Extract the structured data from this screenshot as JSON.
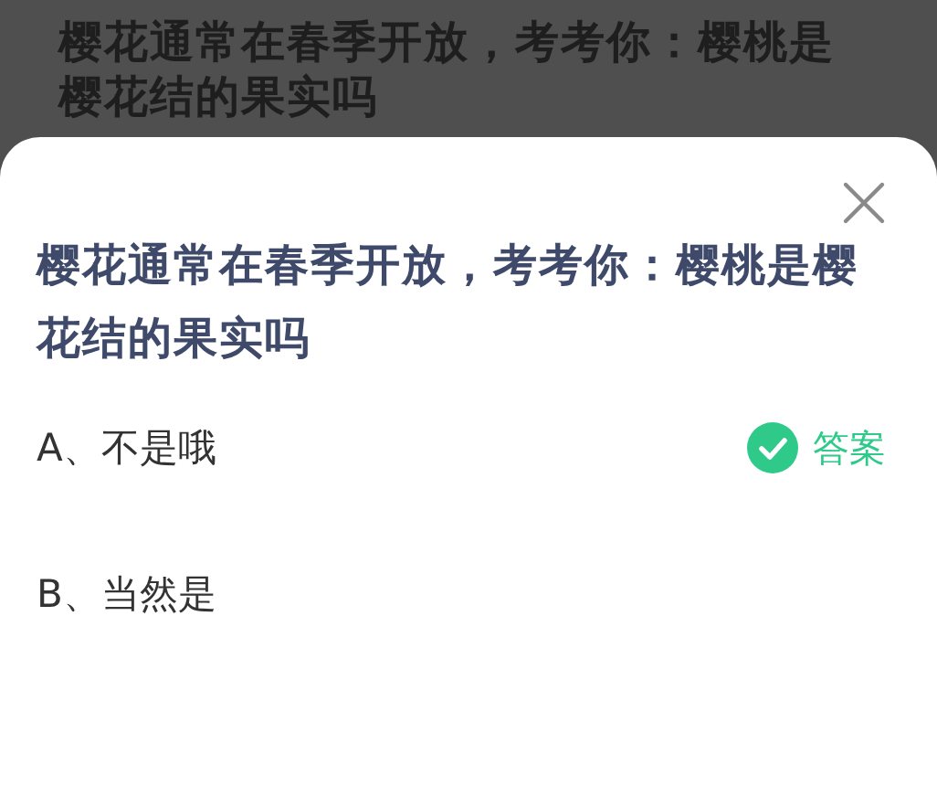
{
  "background_page": {
    "title": "樱花通常在春季开放，考考你：樱桃是樱花结的果实吗"
  },
  "dialog": {
    "question": "樱花通常在春季开放，考考你：樱桃是樱花结的果实吗",
    "answer_label": "答案",
    "options": [
      {
        "label": "A、不是哦",
        "correct": true
      },
      {
        "label": "B、当然是",
        "correct": false
      }
    ]
  }
}
